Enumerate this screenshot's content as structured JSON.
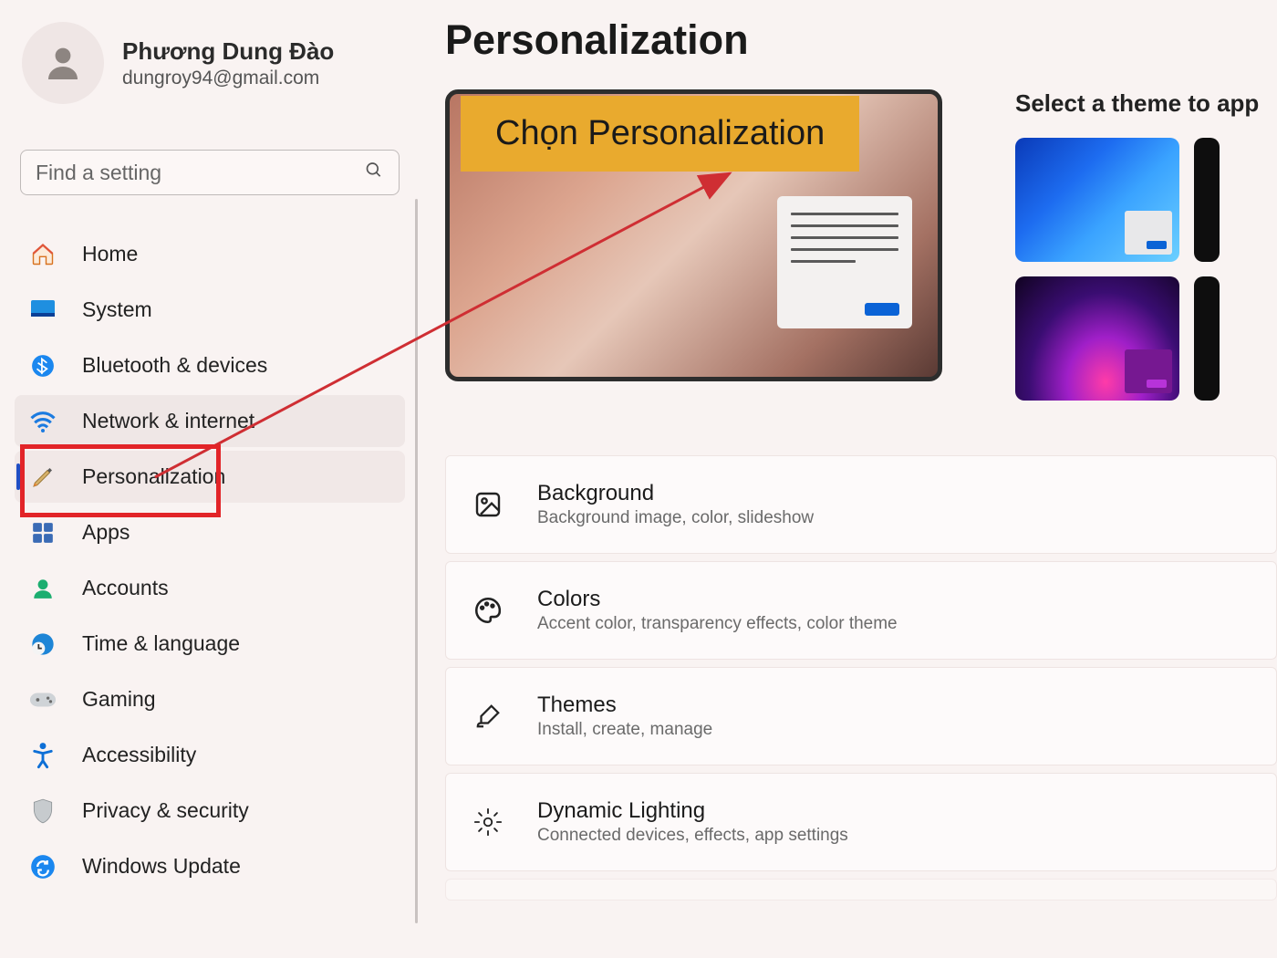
{
  "user": {
    "name": "Phương Dung Đào",
    "email": "dungroy94@gmail.com"
  },
  "search": {
    "placeholder": "Find a setting"
  },
  "sidebar": {
    "items": [
      {
        "id": "home",
        "label": "Home"
      },
      {
        "id": "system",
        "label": "System"
      },
      {
        "id": "bluetooth",
        "label": "Bluetooth & devices"
      },
      {
        "id": "network",
        "label": "Network & internet"
      },
      {
        "id": "personalization",
        "label": "Personalization"
      },
      {
        "id": "apps",
        "label": "Apps"
      },
      {
        "id": "accounts",
        "label": "Accounts"
      },
      {
        "id": "time",
        "label": "Time & language"
      },
      {
        "id": "gaming",
        "label": "Gaming"
      },
      {
        "id": "accessibility",
        "label": "Accessibility"
      },
      {
        "id": "privacy",
        "label": "Privacy & security"
      },
      {
        "id": "update",
        "label": "Windows Update"
      }
    ],
    "selected_index": 4,
    "hover_index": 3
  },
  "page": {
    "title": "Personalization",
    "themes_heading": "Select a theme to app",
    "settings": [
      {
        "id": "background",
        "title": "Background",
        "desc": "Background image, color, slideshow"
      },
      {
        "id": "colors",
        "title": "Colors",
        "desc": "Accent color, transparency effects, color theme"
      },
      {
        "id": "themes",
        "title": "Themes",
        "desc": "Install, create, manage"
      },
      {
        "id": "dynamic-lighting",
        "title": "Dynamic Lighting",
        "desc": "Connected devices, effects, app settings"
      }
    ]
  },
  "annotation": {
    "label": "Chọn Personalization"
  },
  "colors": {
    "highlight": "#e22428",
    "annotation_bg": "#e9aa2e",
    "accent": "#0a63d6"
  }
}
